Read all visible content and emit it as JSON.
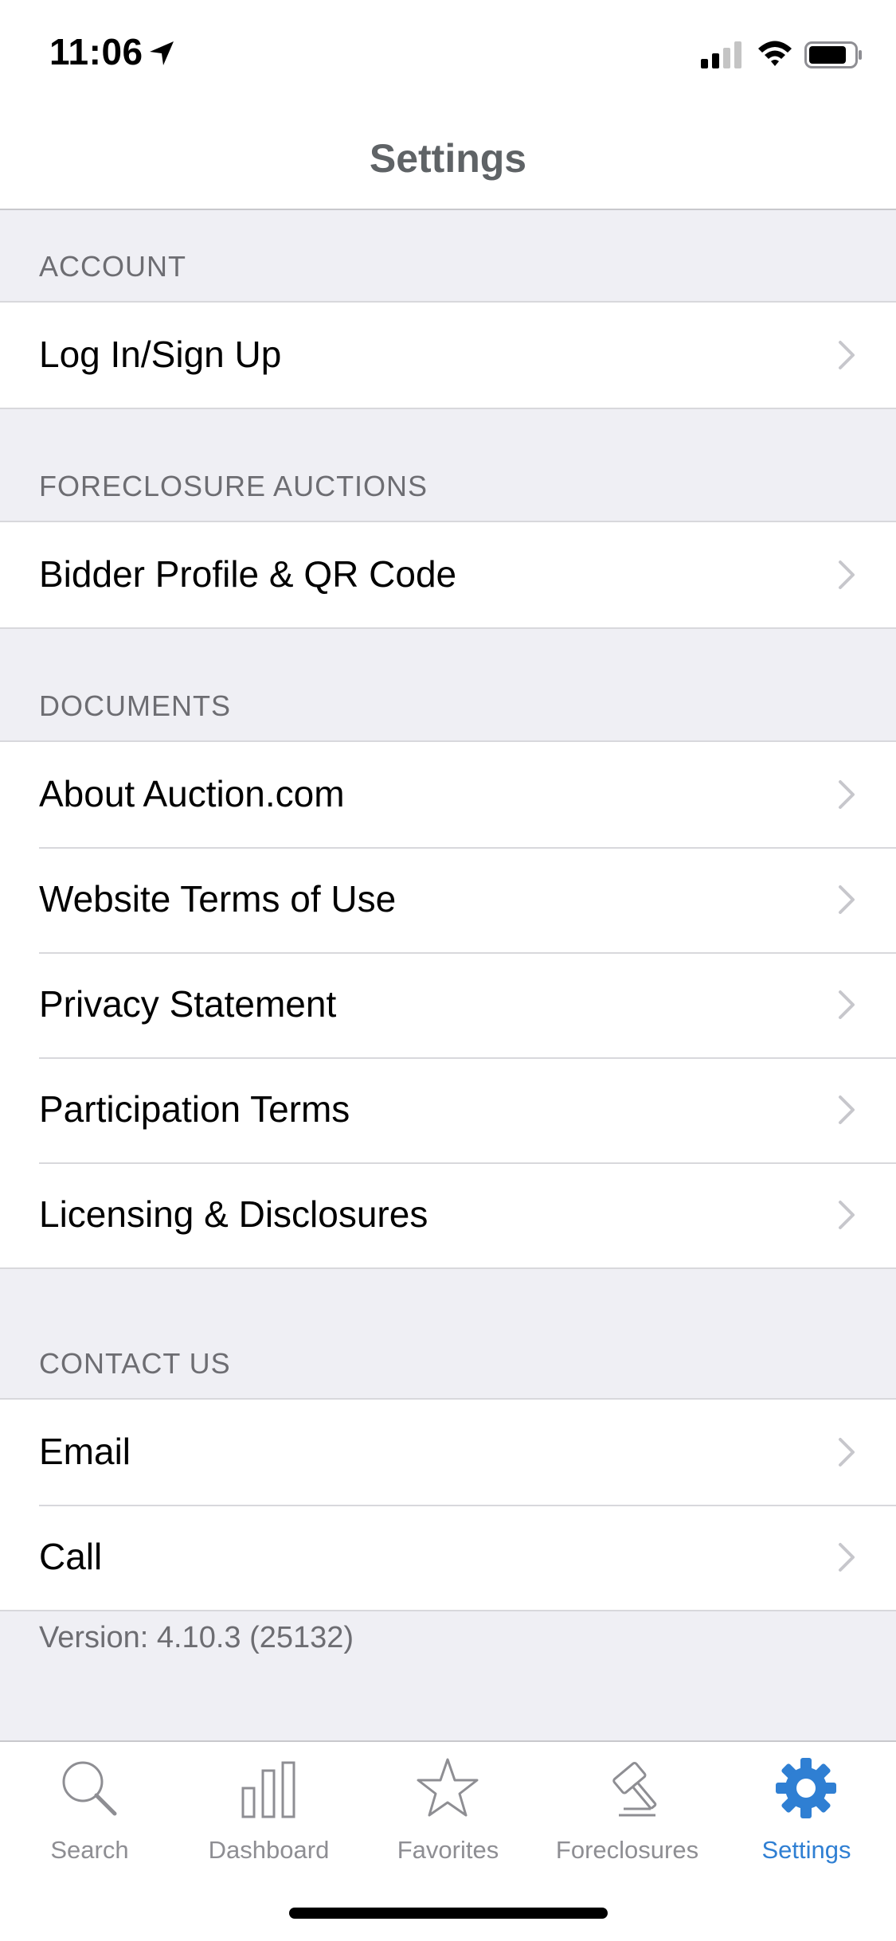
{
  "status_bar": {
    "time": "11:06"
  },
  "nav": {
    "title": "Settings"
  },
  "sections": {
    "account": {
      "header": "ACCOUNT",
      "rows": [
        "Log In/Sign Up"
      ]
    },
    "auctions": {
      "header": "FORECLOSURE AUCTIONS",
      "rows": [
        "Bidder Profile & QR Code"
      ]
    },
    "documents": {
      "header": "DOCUMENTS",
      "rows": [
        "About Auction.com",
        "Website Terms of Use",
        "Privacy Statement",
        "Participation Terms",
        "Licensing & Disclosures"
      ]
    },
    "contact": {
      "header": "CONTACT US",
      "rows": [
        "Email",
        "Call"
      ]
    }
  },
  "version": "Version: 4.10.3 (25132)",
  "tabs": [
    {
      "label": "Search",
      "icon": "search-icon",
      "active": false
    },
    {
      "label": "Dashboard",
      "icon": "bar-chart-icon",
      "active": false
    },
    {
      "label": "Favorites",
      "icon": "star-icon",
      "active": false
    },
    {
      "label": "Foreclosures",
      "icon": "gavel-icon",
      "active": false
    },
    {
      "label": "Settings",
      "icon": "gear-icon",
      "active": true
    }
  ],
  "colors": {
    "accent": "#2f7fd3",
    "inactive": "#8e8e93",
    "background": "#efeff4"
  }
}
